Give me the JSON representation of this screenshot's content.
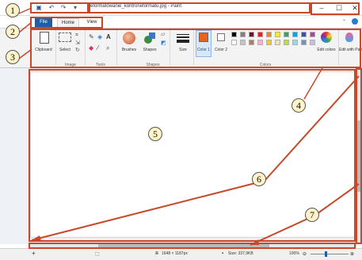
{
  "window": {
    "title": "reformatowanie_kontroneformatu.jpg - Paint",
    "quick_access": [
      "save-icon",
      "undo-icon",
      "redo-icon",
      "customize-icon"
    ],
    "controls": {
      "minimize": "–",
      "maximize": "☐",
      "close": "✕"
    }
  },
  "tabs": [
    "File",
    "Home",
    "View"
  ],
  "ribbon": {
    "clipboard": {
      "label": "Clipboard"
    },
    "image": {
      "select": "Select",
      "group": "Image"
    },
    "tools": {
      "group": "Tools"
    },
    "shapes": {
      "brushes": "Brushes",
      "shapes": "Shapes",
      "group": "Shapes"
    },
    "size": {
      "label": "Size"
    },
    "colors": {
      "color1": "Color 1",
      "color2": "Color 2",
      "edit_colors": "Edit colors",
      "edit_paint3d": "Edit with Paint 3D",
      "group": "Colors",
      "color1_value": "#e8641d",
      "palette": [
        "#000000",
        "#7f7f7f",
        "#880015",
        "#ed1c24",
        "#ff7f27",
        "#fff200",
        "#22b14c",
        "#00a2e8",
        "#3f48cc",
        "#a349a4",
        "#ffffff",
        "#c3c3c3",
        "#b97a57",
        "#ffaec9",
        "#ffc90e",
        "#efe4b0",
        "#b5e61d",
        "#99d9ea",
        "#7092be",
        "#c8bfe7"
      ]
    }
  },
  "status": {
    "dimensions": "1648 × 1187px",
    "size": "Size: 337,9KB",
    "zoom": "100%"
  },
  "annotations": [
    "1",
    "2",
    "3",
    "4",
    "5",
    "6",
    "7"
  ],
  "annotation_color": "#c8482a"
}
